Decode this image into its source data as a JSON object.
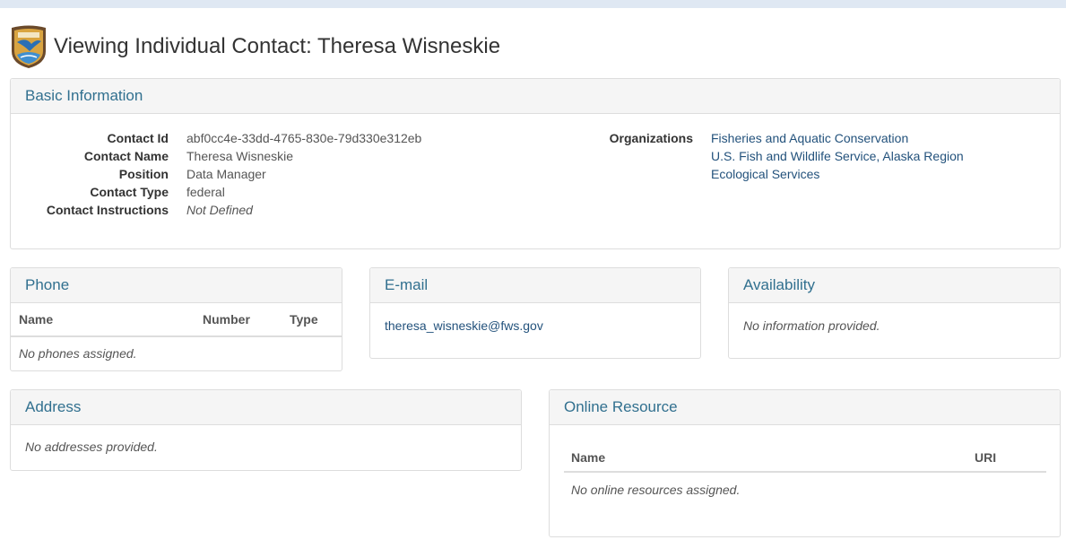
{
  "page": {
    "title": "Viewing Individual Contact: Theresa Wisneskie",
    "logo_icon": "usfws-shield-logo-icon"
  },
  "colors": {
    "top_bar": "#dfe8f3",
    "panel_heading_text": "#31708f",
    "link": "#23527c",
    "panel_heading_bg": "#f5f5f5",
    "border": "#dddddd"
  },
  "basic_info": {
    "heading": "Basic Information",
    "fields": [
      {
        "label": "Contact Id",
        "value": "abf0cc4e-33dd-4765-830e-79d330e312eb"
      },
      {
        "label": "Contact Name",
        "value": "Theresa Wisneskie"
      },
      {
        "label": "Position",
        "value": "Data Manager"
      },
      {
        "label": "Contact Type",
        "value": "federal"
      },
      {
        "label": "Contact Instructions",
        "value": "Not Defined"
      }
    ],
    "organizations_label": "Organizations",
    "organizations": [
      "Fisheries and Aquatic Conservation",
      "U.S. Fish and Wildlife Service, Alaska Region",
      "Ecological Services"
    ]
  },
  "phone": {
    "heading": "Phone",
    "columns": [
      "Name",
      "Number",
      "Type"
    ],
    "empty_message": "No phones assigned."
  },
  "email": {
    "heading": "E-mail",
    "address": "theresa_wisneskie@fws.gov"
  },
  "availability": {
    "heading": "Availability",
    "empty_message": "No information provided."
  },
  "address": {
    "heading": "Address",
    "empty_message": "No addresses provided."
  },
  "online_resource": {
    "heading": "Online Resource",
    "columns": [
      "Name",
      "URI"
    ],
    "empty_message": "No online resources assigned."
  }
}
